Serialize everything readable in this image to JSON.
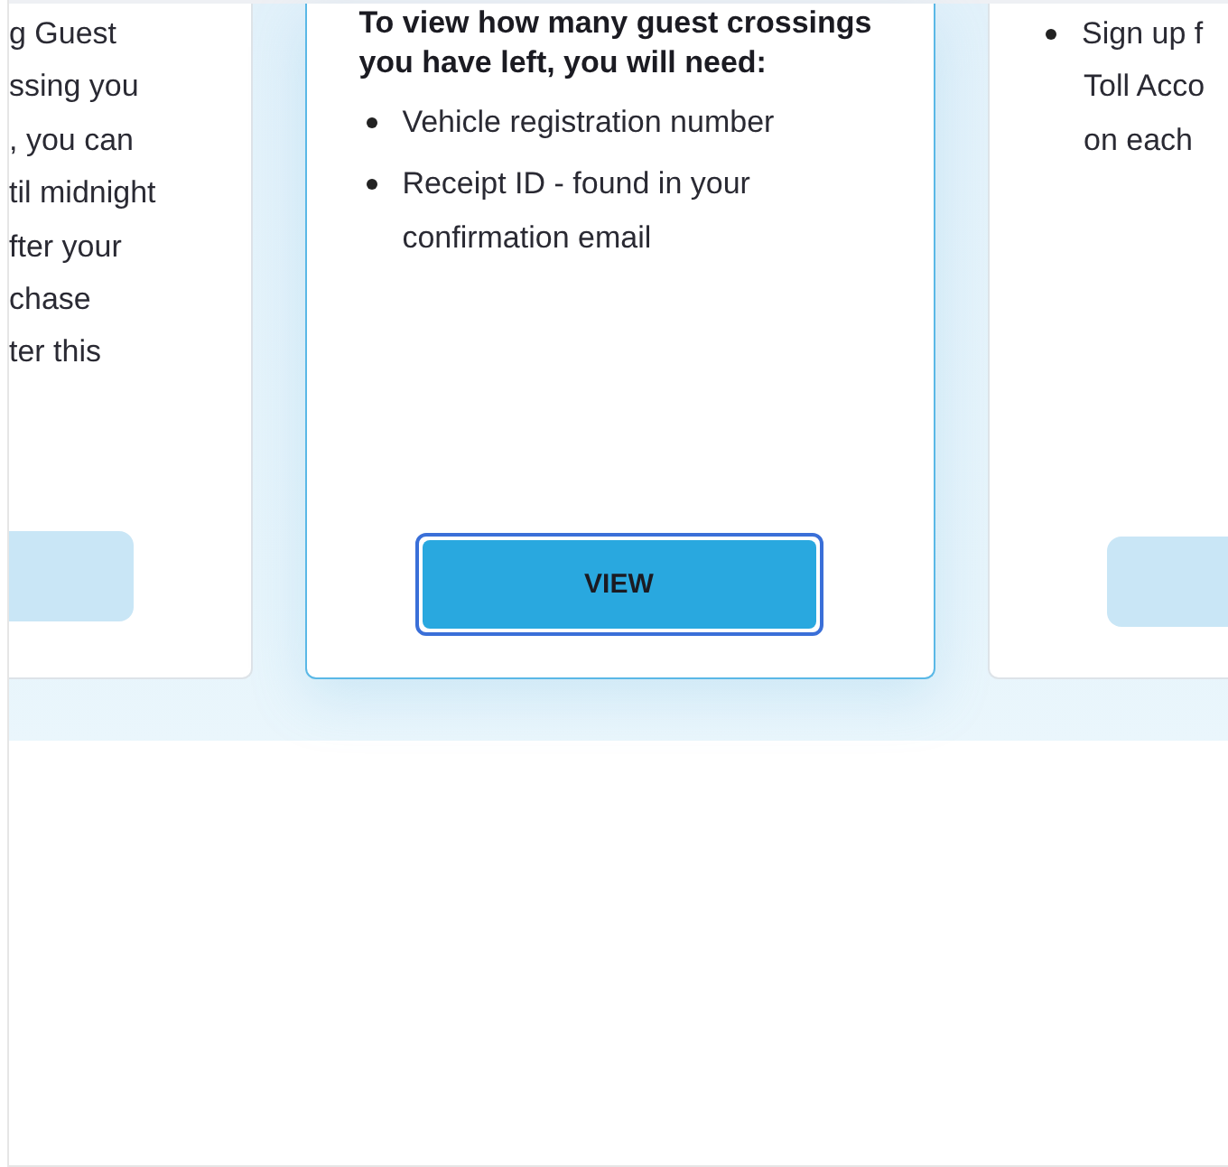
{
  "left_card": {
    "text_lines": [
      "g Guest",
      "ssing you",
      ", you can",
      "til midnight",
      "fter your",
      "chase",
      "ter this"
    ]
  },
  "center_card": {
    "heading": "To view how many guest crossings you have left, you will need:",
    "requirements": [
      "Vehicle registration number",
      "Receipt ID - found in your confirmation email"
    ],
    "button": "VIEW"
  },
  "right_card": {
    "bullet_lines": [
      "Sign up f",
      "Toll Acco",
      "on each"
    ]
  }
}
